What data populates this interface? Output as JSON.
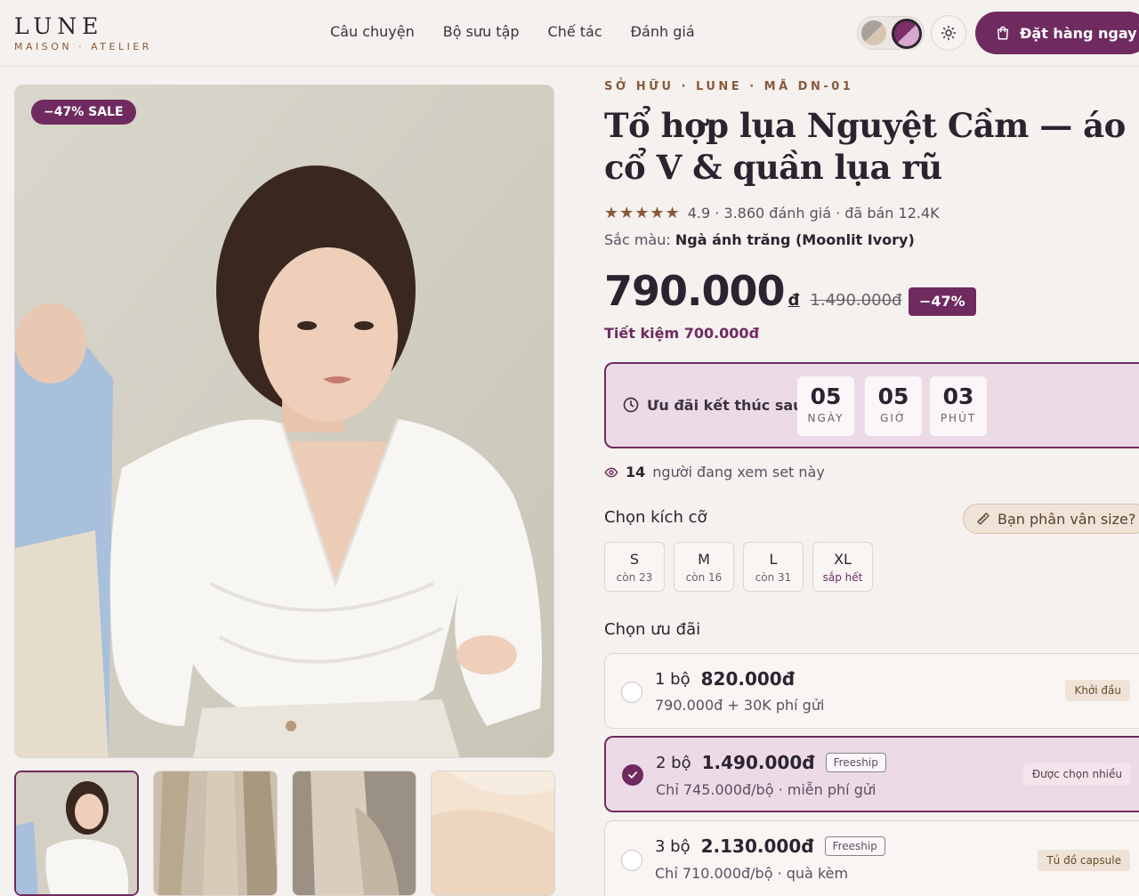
{
  "brand": {
    "name": "LUNE",
    "tagline": "MAISON · ATELIER"
  },
  "nav": [
    "Câu chuyện",
    "Bộ sưu tập",
    "Chế tác",
    "Đánh giá"
  ],
  "header": {
    "order_button": "Đặt hàng ngay",
    "swatches": [
      "#a8a19c",
      "#7b2e68"
    ]
  },
  "gallery": {
    "sale_badge": "−47% SALE",
    "thumb_count": 4
  },
  "product": {
    "eyebrow": "SỞ HỮU · LUNE · MÃ DN-01",
    "title": "Tổ hợp lụa Nguyệt Cầm — áo cổ V & quần lụa rũ",
    "stars": "★★★★★",
    "rating_text": "4.9 · 3.860 đánh giá · đã bán 12.4K",
    "color_label": "Sắc màu:",
    "color_value": "Ngà ánh trăng (Moonlit Ivory)",
    "price": "790.000",
    "currency": "đ",
    "old_price": "1.490.000đ",
    "discount": "−47%",
    "savings": "Tiết kiệm 700.000đ"
  },
  "countdown": {
    "label": "Ưu đãi kết thúc sau",
    "units": [
      {
        "value": "05",
        "label": "NGÀY"
      },
      {
        "value": "05",
        "label": "GIỜ"
      },
      {
        "value": "03",
        "label": "PHÚT"
      }
    ]
  },
  "viewers": {
    "count": "14",
    "text": "người đang xem set này"
  },
  "sizes": {
    "label": "Chọn kích cỡ",
    "guide_button": "Bạn phân vân size?",
    "options": [
      {
        "name": "S",
        "stock": "còn 23"
      },
      {
        "name": "M",
        "stock": "còn 16"
      },
      {
        "name": "L",
        "stock": "còn 31"
      },
      {
        "name": "XL",
        "stock": "sắp hết"
      }
    ]
  },
  "offers": {
    "label": "Chọn ưu đãi",
    "items": [
      {
        "qty": "1 bộ",
        "price": "820.000đ",
        "tag": "",
        "sub": "790.000đ + 30K phí gửi",
        "badge": "Khởi đầu",
        "selected": false
      },
      {
        "qty": "2 bộ",
        "price": "1.490.000đ",
        "tag": "Freeship",
        "sub": "Chỉ 745.000đ/bộ · miễn phí gửi",
        "badge": "Được chọn nhiều",
        "selected": true
      },
      {
        "qty": "3 bộ",
        "price": "2.130.000đ",
        "tag": "Freeship",
        "sub": "Chỉ 710.000đ/bộ · quà kèm",
        "badge": "Tủ đồ capsule",
        "selected": false
      }
    ]
  },
  "colors": {
    "accent": "#6f2b60",
    "brown": "#8a5a3b",
    "background": "#f5f1ee",
    "highlight": "#ecdbe6"
  }
}
